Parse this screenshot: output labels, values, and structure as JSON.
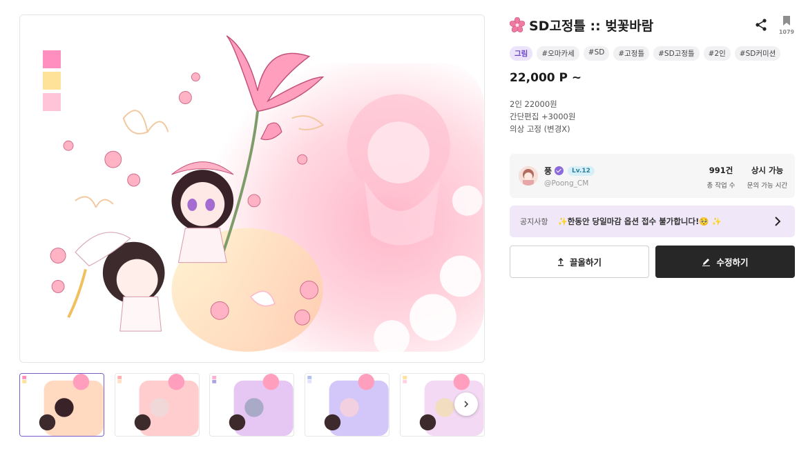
{
  "product": {
    "title": "SD고정틀 :: 벚꽃바람",
    "bookmark_count": "1079",
    "tags": [
      "그림",
      "#오마카세",
      "#SD",
      "#고정틀",
      "#SD고정틀",
      "#2인",
      "#SD커미션"
    ],
    "price": "22,000 P ~",
    "description": [
      "2인 22000원",
      "간단편집 +3000원",
      "의상 고정 (변경X)"
    ]
  },
  "seller": {
    "name": "풍",
    "level": "Lv.12",
    "handle": "@Poong_CM",
    "stats": [
      {
        "value": "991건",
        "label": "총 작업 수"
      },
      {
        "value": "상시 가능",
        "label": "문의 가능 시간"
      }
    ]
  },
  "notice": {
    "label": "공지사항",
    "text": "✨한동안 당일마감 옵션 접수 불가합니다!🥺 ✨"
  },
  "buttons": {
    "pull": "끌올하기",
    "edit": "수정하기"
  },
  "icons": {
    "title": "cherry-blossom-icon",
    "share": "share-icon",
    "bookmark": "bookmark-icon",
    "verify": "verified-badge-icon",
    "notice_arrow": "chevron-right-icon",
    "pull": "upload-arrow-icon",
    "edit": "pencil-icon",
    "thumb_next": "chevron-right-icon"
  },
  "colors": {
    "accent": "#7a5bc9",
    "primary_button": "#272727",
    "notice_bg": "#f0e8f8",
    "palette": [
      "#ff8fbf",
      "#ffe29a",
      "#ffc4d8"
    ]
  },
  "thumbnails": [
    {
      "name": "variant-1",
      "tint": "#ffd0b0",
      "active": true
    },
    {
      "name": "variant-2",
      "tint": "#ffc0c0",
      "active": false
    },
    {
      "name": "variant-3",
      "tint": "#e0b8f0",
      "active": false
    },
    {
      "name": "variant-4",
      "tint": "#c8b8f8",
      "active": false
    },
    {
      "name": "variant-5",
      "tint": "#f0d0f0",
      "active": false
    }
  ]
}
